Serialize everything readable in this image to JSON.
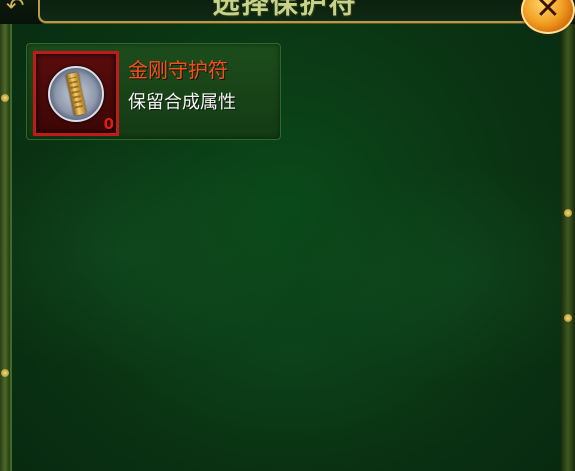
{
  "dialog": {
    "title": "选择保护符",
    "close_label": "✕"
  },
  "items": [
    {
      "name": "金刚守护符",
      "description": "保留合成属性",
      "count": "0",
      "icon": "amulet-icon"
    }
  ],
  "colors": {
    "panel_bg": "#0b3e16",
    "title_text": "#c9d28a",
    "item_name": "#ff4a1c",
    "item_desc": "#f4f4f2",
    "slot_border": "#c01a1a",
    "count": "#e31b10",
    "close_button": "#f3a326"
  }
}
